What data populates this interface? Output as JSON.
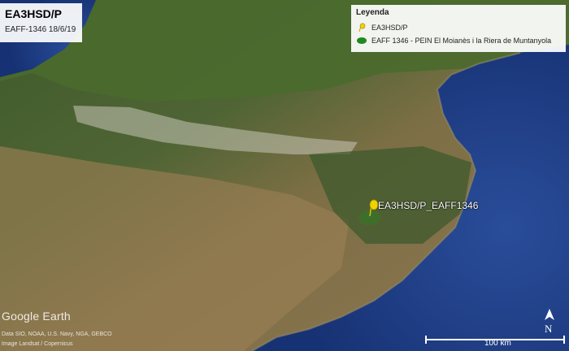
{
  "header": {
    "title": "EA3HSD/P",
    "subtitle": "EAFF-1346 18/6/19"
  },
  "legend": {
    "title": "Leyenda",
    "items": [
      {
        "icon": "yellow-pushpin-icon",
        "label": "EA3HSD/P",
        "color": "#f2d200"
      },
      {
        "icon": "green-area-icon",
        "label": "EAFF 1346 - PEIN El Moianès i la Riera de Muntanyola",
        "color": "#1e8a1e"
      }
    ]
  },
  "marker": {
    "label": "EA3HSD/P_EAFF1346",
    "color": "#f2d200"
  },
  "map": {
    "sea_color": "#1e3f86",
    "land_color": "#6a6e3c"
  },
  "footer": {
    "watermark": "Google Earth",
    "credit_1": "Data SIO, NOAA, U.S. Navy, NGA, GEBCO",
    "credit_2": "Image Landsat / Copernicus",
    "scale_label": "100 km",
    "north_label": "N"
  }
}
